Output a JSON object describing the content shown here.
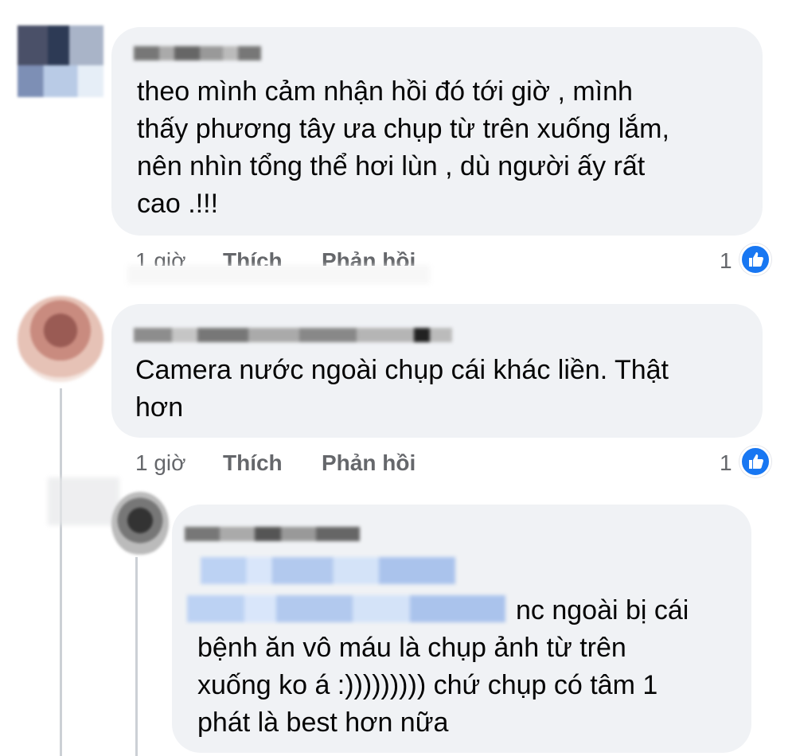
{
  "comments": [
    {
      "text": "theo mình cảm nhận hồi đó tới giờ , mình\nthấy phương tây ưa chụp từ trên xuống lắm,\nnên nhìn tổng thể hơi lùn , dù người ấy rất\ncao .!!!",
      "time": "1 giờ",
      "like_label": "Thích",
      "reply_label": "Phản hồi",
      "like_count": "1"
    },
    {
      "text": "Camera nước ngoài chụp cái khác liền. Thật\nhơn",
      "time": "1 giờ",
      "like_label": "Thích",
      "reply_label": "Phản hồi",
      "like_count": "1"
    },
    {
      "text": "nc ngoài bị cái\nbệnh ăn vô máu là chụp ảnh từ trên\nxuống ko á :))))))))) chứ chụp có tâm 1\nphát là best hơn nữa"
    }
  ],
  "colors": {
    "bubble": "#f0f2f5",
    "meta_text": "#65676b",
    "like_blue": "#1877f2"
  },
  "icons": [
    "thumbs-up-icon"
  ]
}
